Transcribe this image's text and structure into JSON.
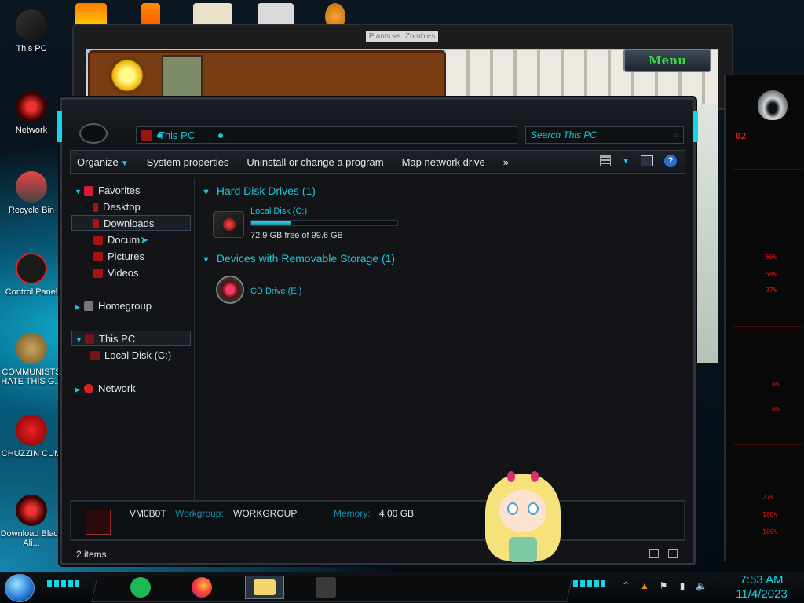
{
  "desktop": {
    "icons": [
      {
        "label": "This PC",
        "icon": "computer-icon"
      },
      {
        "label": "Network",
        "icon": "network-globe-icon"
      },
      {
        "label": "Recycle Bin",
        "icon": "recycle-bin-icon"
      },
      {
        "label": "Control Panel",
        "icon": "control-panel-icon"
      },
      {
        "label": "COMMUNISTS HATE THIS G...",
        "icon": "money-bag-icon"
      },
      {
        "label": "CHUZZIN CUM",
        "icon": "chuzzle-icon"
      },
      {
        "label": "Download Black Ali...",
        "icon": "download-theme-icon"
      }
    ]
  },
  "game_window": {
    "title": "Plants vs. Zombies",
    "menu_label": "Menu"
  },
  "explorer": {
    "address_crumb": "This PC",
    "search_placeholder": "Search This PC",
    "toolbar": {
      "organize": "Organize",
      "system_properties": "System properties",
      "uninstall": "Uninstall or change a program",
      "map_drive": "Map network drive",
      "more": "»"
    },
    "nav": {
      "favorites": "Favorites",
      "desktop": "Desktop",
      "downloads": "Downloads",
      "documents": "Docum",
      "pictures": "Pictures",
      "videos": "Videos",
      "homegroup": "Homegroup",
      "this_pc": "This PC",
      "local_disk": "Local Disk (C:)",
      "network": "Network"
    },
    "groups": {
      "hdd_header": "Hard Disk Drives (1)",
      "removable_header": "Devices with Removable Storage (1)"
    },
    "drives": {
      "c_name": "Local Disk (C:)",
      "c_free": "72.9 GB free of 99.6 GB",
      "c_used_fraction": 0.268,
      "e_name": "CD Drive (E:)"
    },
    "details": {
      "computer_name": "VM0B0T",
      "workgroup_label": "Workgroup:",
      "workgroup_value": "WORKGROUP",
      "memory_label": "Memory:",
      "memory_value": "4.00 GB"
    },
    "status": {
      "item_count": "2 items"
    }
  },
  "gadget": {
    "readouts": [
      "02",
      "56%",
      "58%",
      "37%",
      "0%",
      "0%",
      "27%",
      "100%",
      "100%"
    ]
  },
  "taskbar": {
    "apps": [
      "spotify-icon",
      "firefox-icon",
      "file-explorer-icon",
      "plants-vs-zombies-icon"
    ],
    "time": "7:53 AM",
    "date": "11/4/2023"
  }
}
